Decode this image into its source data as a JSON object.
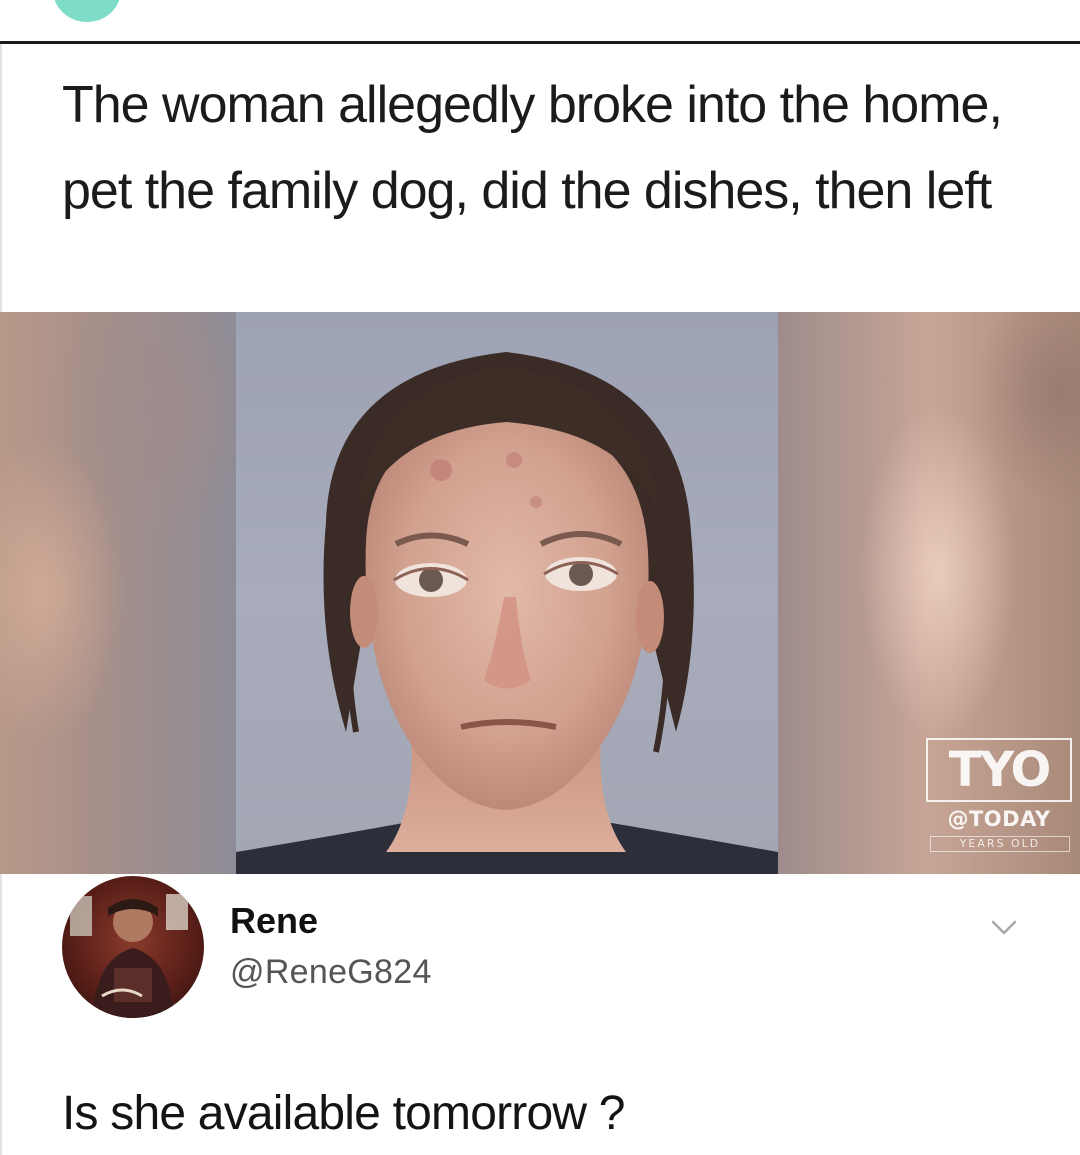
{
  "headline": {
    "text": "The woman allegedly broke into the home, pet the family dog, did the dishes, then left"
  },
  "photo": {
    "watermark_logo": "TYO",
    "watermark_brand": "@TODAY",
    "watermark_sub": "YEARS OLD"
  },
  "tweet": {
    "display_name": "Rene",
    "handle": "@ReneG824",
    "text": "Is she available tomorrow ?",
    "menu_icon": "chevron-down-icon"
  },
  "colors": {
    "top_dot": "#7fdcc7",
    "handle_gray": "#555555",
    "rule": "#1a1a1a"
  }
}
